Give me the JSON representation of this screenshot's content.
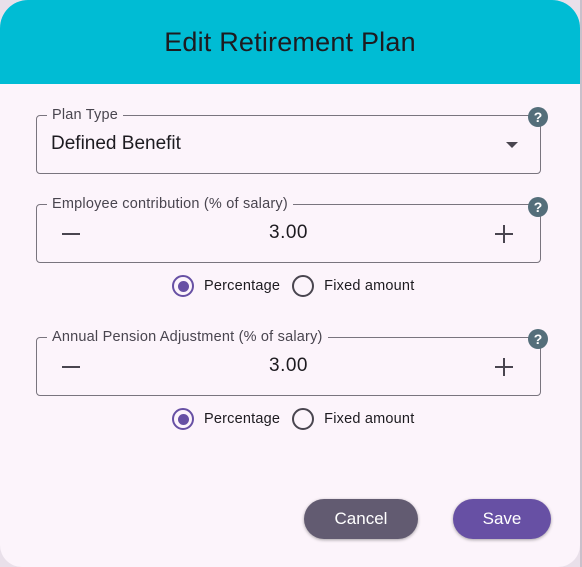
{
  "dialog": {
    "title": "Edit Retirement Plan",
    "header_color": "#00bcd4",
    "help_glyph": "?"
  },
  "plan_type": {
    "label": "Plan Type",
    "value": "Defined Benefit"
  },
  "employee_contribution": {
    "label": "Employee contribution (% of salary)",
    "value": "3.00",
    "options": [
      "Percentage",
      "Fixed amount"
    ],
    "selected": "Percentage"
  },
  "pension_adjustment": {
    "label": "Annual Pension Adjustment (% of salary)",
    "value": "3.00",
    "options": [
      "Percentage",
      "Fixed amount"
    ],
    "selected": "Percentage"
  },
  "actions": {
    "cancel": "Cancel",
    "save": "Save"
  },
  "colors": {
    "primary": "#6750a4",
    "secondary": "#625b71",
    "help": "#546e7a"
  }
}
